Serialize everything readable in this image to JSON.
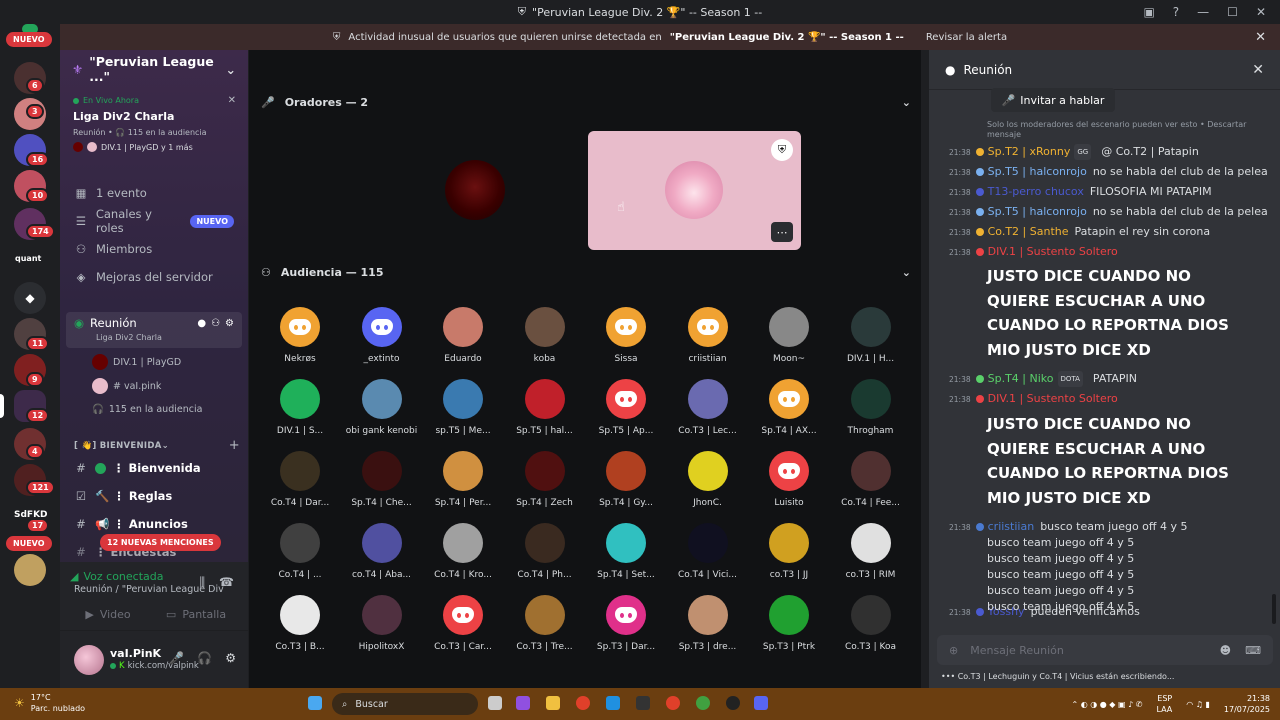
{
  "window": {
    "title": "\"Peruvian League Div. 2 🏆\" -- Season 1 --"
  },
  "alert": {
    "prefix": "Actividad inusual de usuarios que quieren unirse detectada en",
    "server": "\"Peruvian League Div. 2 🏆\" -- Season 1 --",
    "action": "Revisar la alerta"
  },
  "guilds": {
    "new_top": "NUEVO",
    "new_bottom": "NUEVO",
    "badges": [
      "6",
      "3",
      "16",
      "10",
      "174",
      "11",
      "9",
      "12",
      "4",
      "121",
      "17"
    ],
    "quant_label": "quant",
    "sdfkd_label": "SdFKD"
  },
  "server": {
    "name": "\"Peruvian League ...\"",
    "live_label": "En Vivo Ahora",
    "stage_title": "Liga Div2 Charla",
    "stage_sub": "Reunión • 🎧 115 en la audiencia",
    "stage_people": "DIV.1 | PlayGD y 1 más"
  },
  "sidebar": {
    "items": [
      {
        "label": "1 evento",
        "icon": "calendar-icon"
      },
      {
        "label": "Canales y roles",
        "icon": "channels-icon",
        "badge": "NUEVO"
      },
      {
        "label": "Miembros",
        "icon": "members-icon"
      },
      {
        "label": "Mejoras del servidor",
        "icon": "boost-icon"
      }
    ]
  },
  "stage_channel": {
    "name": "Reunión",
    "sub": "Liga Div2 Charla",
    "users": [
      "DIV.1 | PlayGD",
      "# vaI.pink"
    ],
    "audience": "115 en la audiencia"
  },
  "category": {
    "name": "[ 👋] BIENVENIDA"
  },
  "text_channels": [
    {
      "name": "⋮ Bienvenida"
    },
    {
      "name": "🔨 ⋮ Reglas"
    },
    {
      "name": "📢 ⋮ Anuncios"
    },
    {
      "name": "⋮ Encuestas"
    }
  ],
  "mentions": "12 NUEVAS MENCIONES",
  "voice": {
    "status": "Voz conectada",
    "channel": "Reunión / \"Peruvian League Div. ...",
    "video": "Video",
    "screen": "Pantalla"
  },
  "user": {
    "name": "vaI.PinK",
    "status": "kick.com/valpink"
  },
  "speakers": {
    "header": "Oradores — 2"
  },
  "audience": {
    "header": "Audiencia — 115",
    "members": [
      {
        "name": "Nekrøs",
        "color": "#f0a232",
        "kind": "logo"
      },
      {
        "name": "_extinto",
        "color": "#5865f2",
        "kind": "logo"
      },
      {
        "name": "Eduardo",
        "color": "#c87a6a",
        "kind": "photo"
      },
      {
        "name": "koba",
        "color": "#6a5040",
        "kind": "photo"
      },
      {
        "name": "Sissa",
        "color": "#f0a232",
        "kind": "logo"
      },
      {
        "name": "criistiian",
        "color": "#f0a232",
        "kind": "logo"
      },
      {
        "name": "Moon~",
        "color": "#888888",
        "kind": "photo"
      },
      {
        "name": "DIV.1 | H...",
        "color": "#2a3a3a",
        "kind": "photo"
      },
      {
        "name": "DIV.1 | S...",
        "color": "#1fb05a",
        "kind": "photo"
      },
      {
        "name": "obi gank kenobi",
        "color": "#5a8ab0",
        "kind": "photo"
      },
      {
        "name": "sp.T5 | Me...",
        "color": "#3a7ab0",
        "kind": "photo"
      },
      {
        "name": "Sp.T5 | hal...",
        "color": "#c0202a",
        "kind": "photo"
      },
      {
        "name": "Sp.T5 | Ap...",
        "color": "#ed4245",
        "kind": "logo"
      },
      {
        "name": "Co.T3 | Lec...",
        "color": "#6a6ab0",
        "kind": "photo"
      },
      {
        "name": "Sp.T4 | AX...",
        "color": "#f0a232",
        "kind": "logo"
      },
      {
        "name": "Throgham",
        "color": "#1a3a30",
        "kind": "photo"
      },
      {
        "name": "Co.T4 | Dar...",
        "color": "#3a3020",
        "kind": "photo"
      },
      {
        "name": "Sp.T4 | Che...",
        "color": "#3a1010",
        "kind": "photo"
      },
      {
        "name": "Sp.T4 | Per...",
        "color": "#d09040",
        "kind": "photo"
      },
      {
        "name": "Sp.T4 | Zech",
        "color": "#501010",
        "kind": "photo"
      },
      {
        "name": "Sp.T4 | Gy...",
        "color": "#b04020",
        "kind": "photo"
      },
      {
        "name": "JhonC.",
        "color": "#e0d020",
        "kind": "photo"
      },
      {
        "name": "Luisito",
        "color": "#ed4245",
        "kind": "logo"
      },
      {
        "name": "Co.T4 | Fee...",
        "color": "#503030",
        "kind": "photo"
      },
      {
        "name": "Co.T4 | ...",
        "color": "#404040",
        "kind": "photo"
      },
      {
        "name": "co.T4 | Aba...",
        "color": "#5050a0",
        "kind": "photo"
      },
      {
        "name": "Co.T4 | Kro...",
        "color": "#a0a0a0",
        "kind": "photo"
      },
      {
        "name": "Co.T4 | Ph...",
        "color": "#3a2a20",
        "kind": "photo"
      },
      {
        "name": "Sp.T4 | Set...",
        "color": "#30c0c0",
        "kind": "photo"
      },
      {
        "name": "Co.T4 | Vici...",
        "color": "#101020",
        "kind": "photo"
      },
      {
        "name": "co.T3 | JJ",
        "color": "#d0a020",
        "kind": "photo"
      },
      {
        "name": "co.T3 | RIM",
        "color": "#e0e0e0",
        "kind": "photo"
      },
      {
        "name": "Co.T3 | B...",
        "color": "#e8e8e8",
        "kind": "photo"
      },
      {
        "name": "HipolitoxX",
        "color": "#503040",
        "kind": "photo"
      },
      {
        "name": "Co.T3 | Car...",
        "color": "#ed4245",
        "kind": "logo"
      },
      {
        "name": "Co.T3 | Tre...",
        "color": "#a07030",
        "kind": "photo"
      },
      {
        "name": "Sp.T3 | Dar...",
        "color": "#e0308a",
        "kind": "logo"
      },
      {
        "name": "Sp.T3 | dre...",
        "color": "#c09070",
        "kind": "photo"
      },
      {
        "name": "Sp.T3 | Ptrk",
        "color": "#20a030",
        "kind": "photo"
      },
      {
        "name": "Co.T3 | Koa",
        "color": "#303030",
        "kind": "photo"
      }
    ]
  },
  "chat": {
    "header": "Reunión",
    "invite": "Invitar a hablar",
    "modnote": "Solo los moderadores del escenario pueden ver esto • Descartar mensaje",
    "placeholder": "Mensaje Reunión",
    "typing": "Co.T3 | Lechuguin y  Co.T4 | Vicius están escribiendo...",
    "messages": [
      {
        "time": "21:38",
        "user": "Sp.T2 | xRonny",
        "color": "#f0b232",
        "tag": "GG",
        "text": "@ Co.T2 | Patapin"
      },
      {
        "time": "21:38",
        "user": "Sp.T5 | halconrojo",
        "color": "#7ab0f0",
        "text": "no se habla del club de la pelea"
      },
      {
        "time": "21:38",
        "user": "T13-perro chucox",
        "color": "#4a5ad0",
        "text": "FILOSOFIA MI PATAPIM"
      },
      {
        "time": "21:38",
        "user": "Sp.T5 | halconrojo",
        "color": "#7ab0f0",
        "text": "no se habla del club de la pelea"
      },
      {
        "time": "21:38",
        "user": "Co.T2 | Santhe",
        "color": "#f0b232",
        "text": "Patapin el rey sin corona"
      },
      {
        "time": "21:38",
        "user": "DIV.1 | Sustento Soltero",
        "color": "#ed4245",
        "text": ""
      },
      {
        "time": "21:38",
        "user": "Sp.T4 | Niko",
        "color": "#5ad06a",
        "tag": "DOTA",
        "text": "PATAPIN"
      },
      {
        "time": "21:38",
        "user": "DIV.1 | Sustento Soltero",
        "color": "#ed4245",
        "text": ""
      },
      {
        "time": "21:38",
        "user": "criistiian",
        "color": "#4a7ad0",
        "text": "busco team juego off 4 y 5"
      },
      {
        "time": "21:38",
        "user": "Yosshy",
        "color": "#4a5ad0",
        "text": "pueden verificarnos"
      }
    ],
    "big1": "JUSTO DICE CUANDO NO QUIERE ESCUCHAR A UNO CUANDO LO REPORTNA DIOS MIO JUSTO DICE XD",
    "big2": "JUSTO DICE CUANDO NO QUIERE ESCUCHAR A UNO CUANDO LO REPORTNA DIOS MIO JUSTO DICE XD",
    "continued": [
      "busco team juego off 4 y 5",
      "busco team juego off 4 y 5",
      "busco team juego off 4 y 5",
      "busco team juego off 4 y 5",
      "busco team juego off 4 y 5"
    ]
  },
  "taskbar": {
    "temp": "17°C",
    "weather": "Parc. nublado",
    "search": "Buscar",
    "lang1": "ESP",
    "lang2": "LAA",
    "time": "21:38",
    "date": "17/07/2025"
  }
}
